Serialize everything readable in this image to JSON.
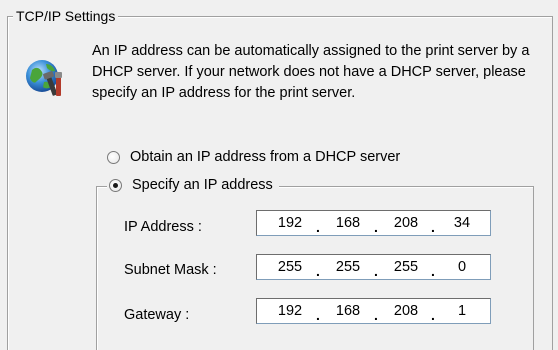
{
  "group_title": "TCP/IP Settings",
  "description": "An IP address can be automatically assigned to the print server by a DHCP server. If your network does not have a DHCP server, please specify an IP address for the print server.",
  "icon": "network-settings-icon",
  "options": {
    "dhcp": {
      "label": "Obtain an IP address from a DHCP server",
      "selected": false
    },
    "static": {
      "label": "Specify an IP address",
      "selected": true
    }
  },
  "fields": {
    "ip_address": {
      "label": "IP Address :",
      "octets": [
        "192",
        "168",
        "208",
        "34"
      ]
    },
    "subnet_mask": {
      "label": "Subnet Mask :",
      "octets": [
        "255",
        "255",
        "255",
        "0"
      ]
    },
    "gateway": {
      "label": "Gateway :",
      "octets": [
        "192",
        "168",
        "208",
        "1"
      ]
    }
  },
  "separator": "."
}
